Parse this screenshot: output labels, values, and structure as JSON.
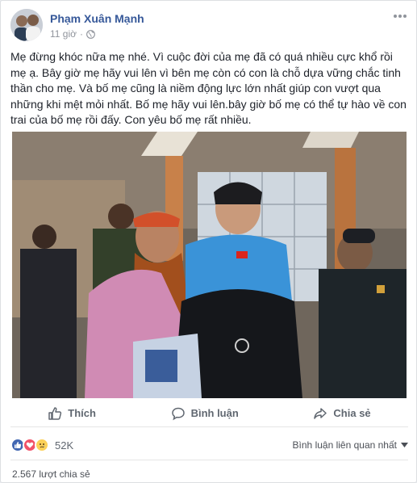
{
  "post": {
    "author": "Phạm Xuân Mạnh",
    "time": "11 giờ",
    "privacy_icon": "globe-icon",
    "text": "Mẹ đừng khóc nữa mẹ nhé. Vì cuộc đời của mẹ đã có quá nhiều cực khổ rồi mẹ ạ. Bây giờ mẹ hãy vui lên vì bên mẹ còn có con là chỗ dựa vững chắc tinh thần cho mẹ. Và bố mẹ cũng là niềm động lực lớn nhất giúp con vượt qua những khi mệt mỏi nhất. Bố mẹ hãy vui lên.bây giờ bố mẹ có thể tự hào về con trai của bố mẹ rồi đấy. Con yêu bố mẹ rất nhiều."
  },
  "actions": {
    "like": "Thích",
    "comment": "Bình luận",
    "share": "Chia sẻ"
  },
  "stats": {
    "reactions_count": "52K",
    "comment_filter": "Bình luận liên quan nhất",
    "shares": "2.567 lượt chia sẻ"
  },
  "colors": {
    "author_link": "#365899",
    "like_blue": "#4267b2",
    "love_red": "#f25268",
    "sad_yellow": "#fcd159",
    "text_gray": "#606770"
  }
}
